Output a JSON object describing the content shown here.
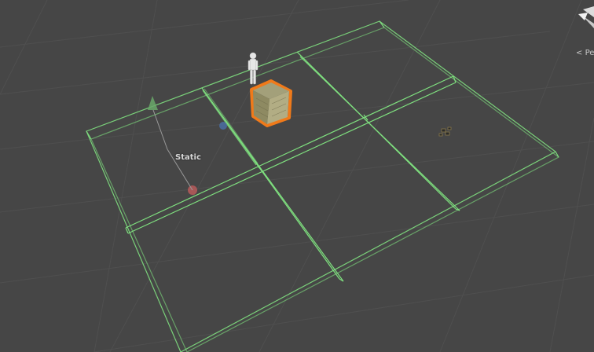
{
  "scene": {
    "static_label": "Static",
    "grid_color": "#4d4d4d",
    "collider_color": "#7fe07f",
    "selection_outline_color": "#f07a1a",
    "background_color": "#464646"
  },
  "gizmo": {
    "projection_label": "Pe",
    "orientation_icon": "scene-orientation-gizmo-icon"
  },
  "objects": {
    "player": "humanoid-figure-icon",
    "selected_object": "cube-icon",
    "axis_handle": "transform-handle-icon",
    "small_object": "small-prop-icon"
  }
}
